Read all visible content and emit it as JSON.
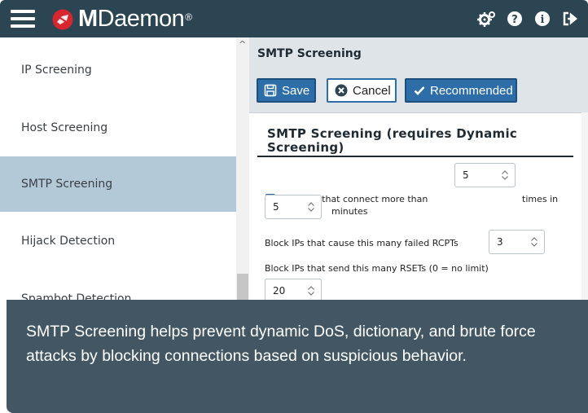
{
  "app": {
    "brand_prefix": "M",
    "brand_rest": "Daemon",
    "brand_mark": "®"
  },
  "topbar_icons": [
    "settings-icon",
    "help-icon",
    "info-icon",
    "logout-icon"
  ],
  "sidebar": {
    "items": [
      {
        "label": "IP Screening",
        "active": false
      },
      {
        "label": "Host Screening",
        "active": false
      },
      {
        "label": "SMTP Screening",
        "active": true
      },
      {
        "label": "Hijack Detection",
        "active": false
      },
      {
        "label": "Spambot Detection",
        "active": false
      }
    ]
  },
  "main": {
    "header_title": "SMTP Screening",
    "toolbar": {
      "save_label": "Save",
      "cancel_label": "Cancel",
      "recommended_label": "Recommended"
    },
    "section_title": "SMTP Screening (requires Dynamic Screening)",
    "block_connect": {
      "checked": true,
      "label": "Block IPs that connect more than",
      "value": "5",
      "suffix": "times in"
    },
    "block_connect_minutes": {
      "value": "5",
      "suffix": "minutes"
    },
    "failed_rcpts": {
      "label": "Block IPs that cause this many failed RCPTs",
      "value": "3"
    },
    "rsets": {
      "label": "Block IPs that send this many RSETs (0 = no limit)",
      "value": "20"
    }
  },
  "caption": "SMTP Screening helps prevent dynamic DoS, dictionary, and brute force attacks by blocking connections based on suspicious behavior.",
  "colors": {
    "topbar": "#2c4553",
    "accent": "#2d6ea8",
    "active_item": "#b3c9d8",
    "caption_bg": "#425763",
    "logo_red": "#d8262e"
  }
}
